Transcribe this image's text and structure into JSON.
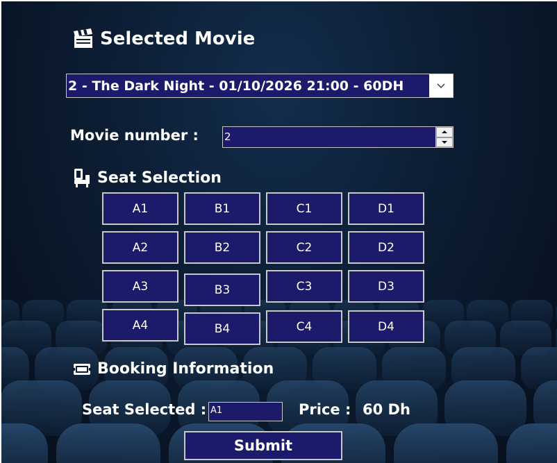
{
  "header": {
    "selected_movie_title": "Selected Movie"
  },
  "movie_select": {
    "selected": "2 - The Dark Night - 01/10/2026 21:00 - 60DH"
  },
  "movie_number": {
    "label": "Movie number :",
    "value": "2"
  },
  "seat_selection": {
    "title": "Seat Selection",
    "seats": [
      "A1",
      "B1",
      "C1",
      "D1",
      "A2",
      "B2",
      "C2",
      "D2",
      "A3",
      "B3",
      "C3",
      "D3",
      "A4",
      "B4",
      "C4",
      "D4"
    ]
  },
  "booking": {
    "title": "Booking Information",
    "seat_label": "Seat Selected :",
    "seat_value": "A1",
    "price_label": "Price :",
    "price_value": "60 Dh",
    "submit_label": "Submit"
  },
  "colors": {
    "field_bg": "#1c1a6b",
    "border": "#c8c8c8",
    "background": "#0c1d33"
  }
}
